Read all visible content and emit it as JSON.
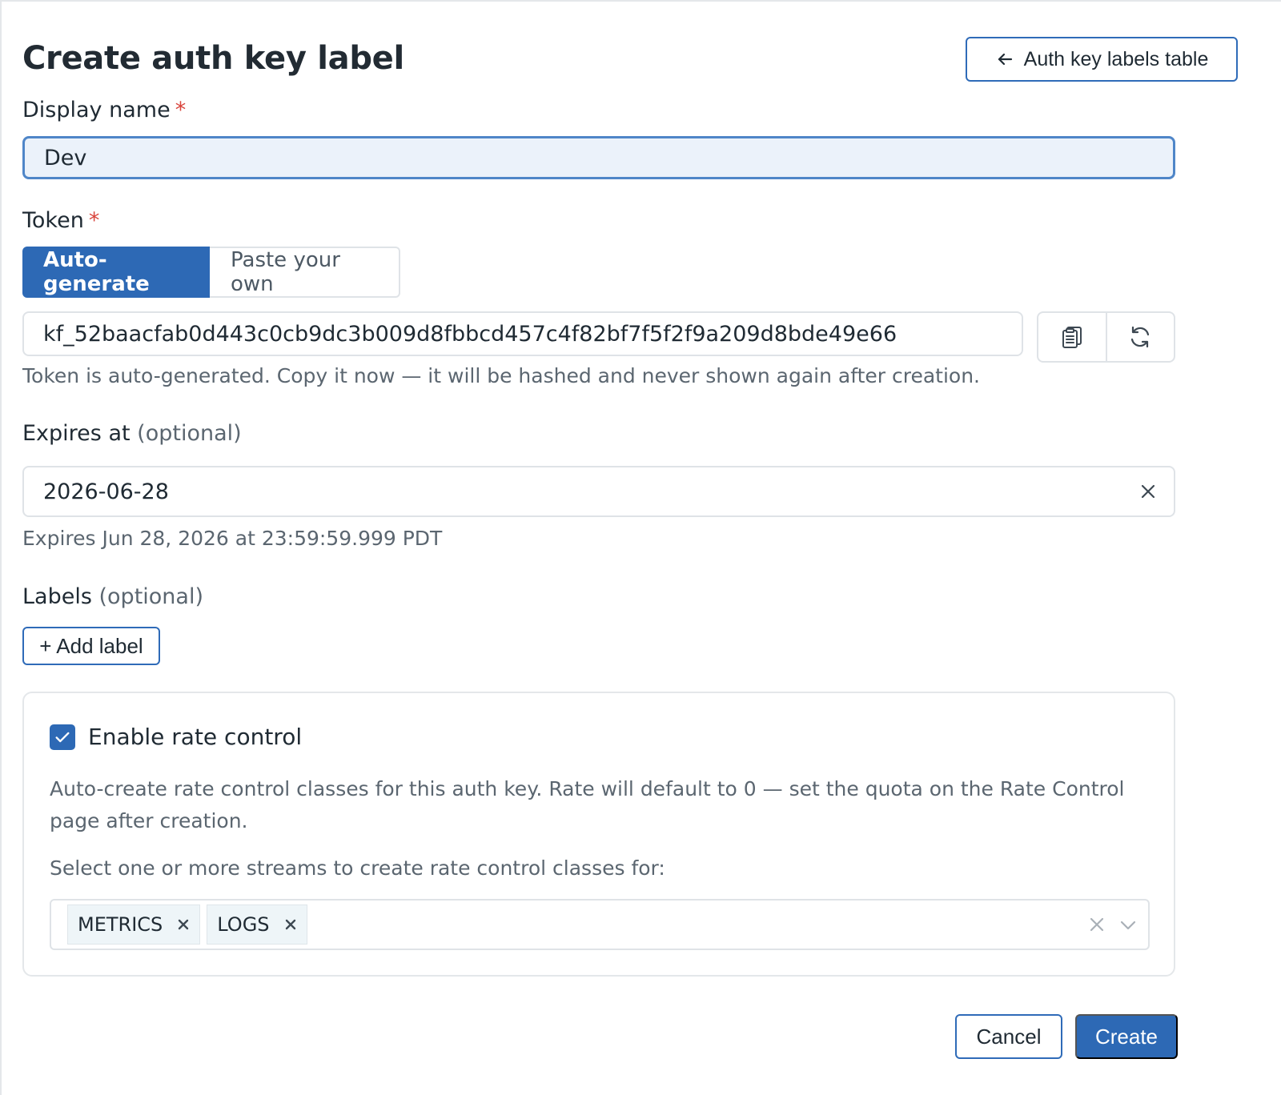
{
  "header": {
    "title": "Create auth key label",
    "back_label": "Auth key labels table"
  },
  "display_name": {
    "label": "Display name",
    "required_mark": "*",
    "value": "Dev"
  },
  "token": {
    "label": "Token",
    "required_mark": "*",
    "modes": [
      "Auto-generate",
      "Paste your own"
    ],
    "active_mode": "Auto-generate",
    "value": "kf_52baacfab0d443c0cb9dc3b009d8fbbcd457c4f82bf7f5f2f9a209d8bde49e66",
    "help": "Token is auto-generated. Copy it now — it will be hashed and never shown again after creation.",
    "icons": [
      "clipboard-icon",
      "refresh-icon"
    ]
  },
  "expires": {
    "label": "Expires at",
    "optional": "(optional)",
    "value": "2026-06-28",
    "help": "Expires Jun 28, 2026 at 23:59:59.999 PDT"
  },
  "labels": {
    "label": "Labels",
    "optional": "(optional)",
    "add_label": "+ Add label"
  },
  "rate_control": {
    "checkbox_label": "Enable rate control",
    "checked": true,
    "description": "Auto-create rate control classes for this auth key. Rate will default to 0 — set the quota on the Rate Control page after creation.",
    "prompt": "Select one or more streams to create rate control classes for:",
    "selected_streams": [
      "METRICS",
      "LOGS"
    ]
  },
  "footer": {
    "cancel": "Cancel",
    "create": "Create"
  },
  "colors": {
    "primary": "#2d69b5",
    "required": "#d9453d",
    "focus_bg": "#ebf2fa"
  }
}
